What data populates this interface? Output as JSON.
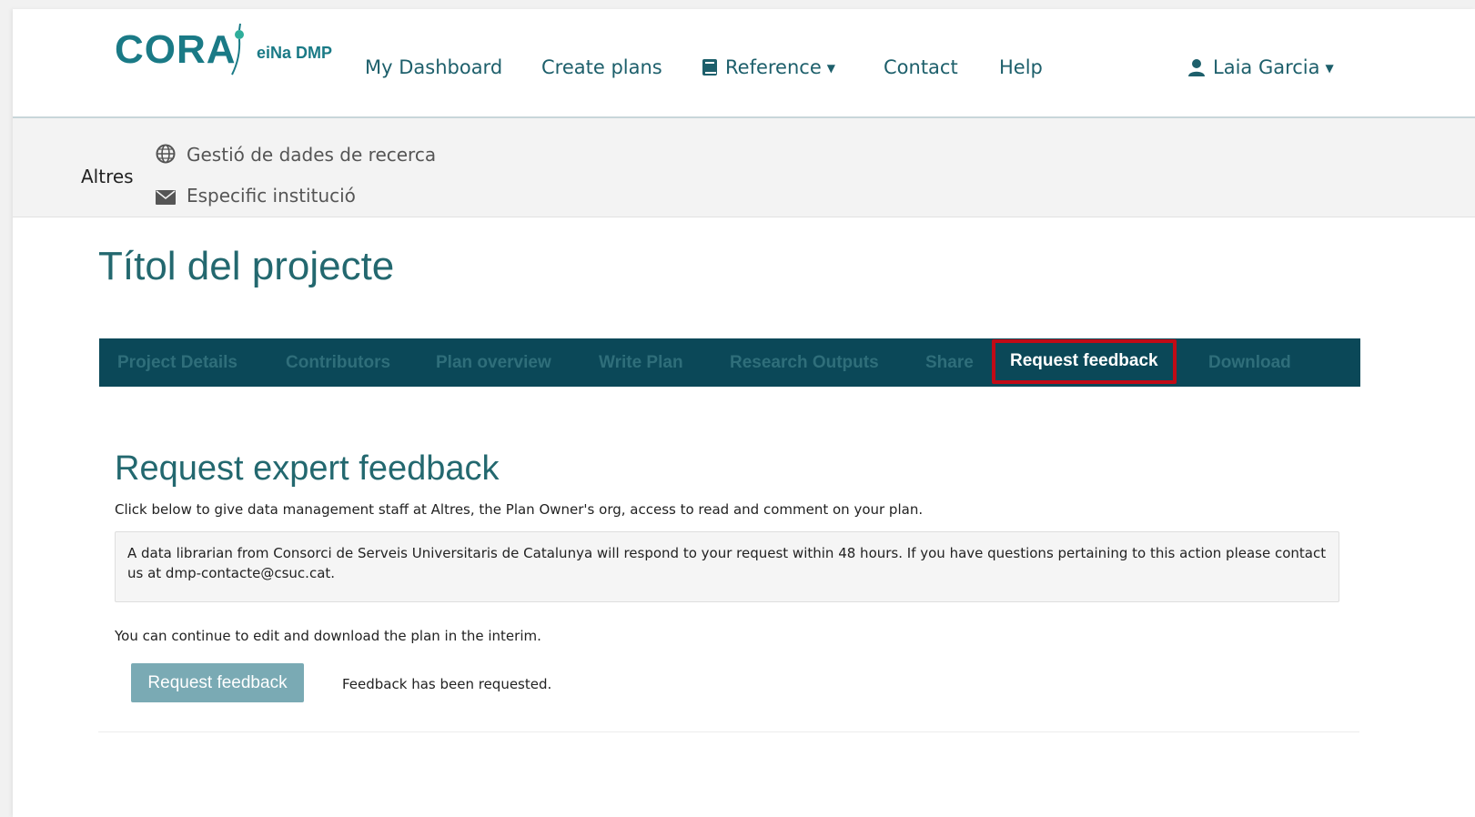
{
  "brand": {
    "name": "CORA",
    "sub": "eiNa DMP",
    "color": "#1a7a86"
  },
  "nav": {
    "dashboard": "My Dashboard",
    "create": "Create plans",
    "reference": "Reference",
    "contact": "Contact",
    "help": "Help",
    "user": "Laia Garcia"
  },
  "org": {
    "name": "Altres",
    "links": [
      "Gestió de dades de recerca",
      "Especific institució"
    ]
  },
  "project": {
    "title": "Títol del projecte"
  },
  "tabs": [
    {
      "label": "Project Details"
    },
    {
      "label": "Contributors"
    },
    {
      "label": "Plan overview"
    },
    {
      "label": "Write Plan"
    },
    {
      "label": "Research Outputs"
    },
    {
      "label": "Share"
    },
    {
      "label": "Request feedback",
      "active": true
    },
    {
      "label": "Download"
    }
  ],
  "feedback": {
    "title": "Request expert feedback",
    "intro": "Click below to give data management staff at Altres, the Plan Owner's org, access to read and comment on your plan.",
    "note": "A data librarian from Consorci de Serveis Universitaris de Catalunya will respond to your request within 48 hours. If you have questions pertaining to this action please contact us at dmp-contacte@csuc.cat.",
    "interim": "You can continue to edit and download the plan in the interim.",
    "button": "Request feedback",
    "status": "Feedback has been requested."
  },
  "colors": {
    "tab_bar": "#0b4858",
    "highlight": "#c10b16",
    "button": "#7aaab4",
    "title": "#23686f"
  }
}
